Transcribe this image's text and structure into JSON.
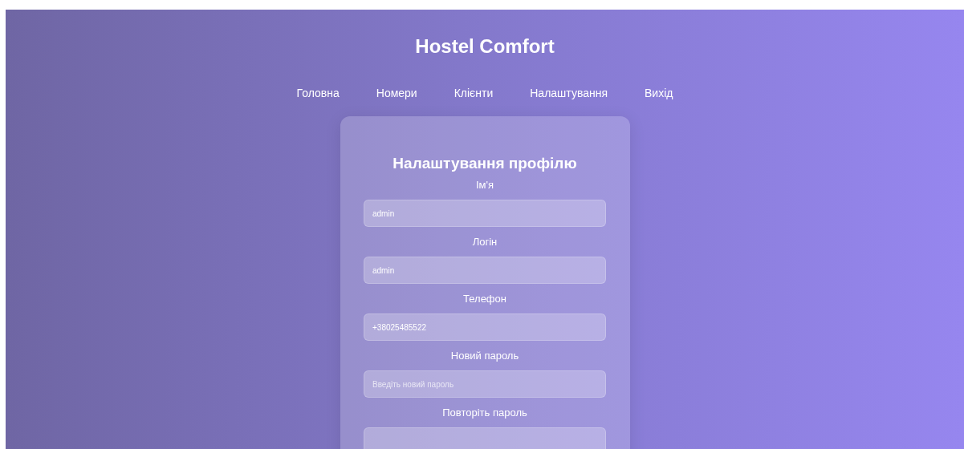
{
  "header": {
    "title": "Hostel Comfort"
  },
  "nav": [
    {
      "label": "Головна"
    },
    {
      "label": "Номери"
    },
    {
      "label": "Клієнти"
    },
    {
      "label": "Налаштування"
    },
    {
      "label": "Вихід"
    }
  ],
  "form": {
    "title": "Налаштування профілю",
    "fields": [
      {
        "label": "Ім'я",
        "value": "admin"
      },
      {
        "label": "Логін",
        "value": "admin"
      },
      {
        "label": "Телефон",
        "value": "+38025485522"
      },
      {
        "label": "Новий пароль",
        "placeholder": "Введіть новий пароль"
      },
      {
        "label": "Повторіть пароль"
      }
    ]
  }
}
